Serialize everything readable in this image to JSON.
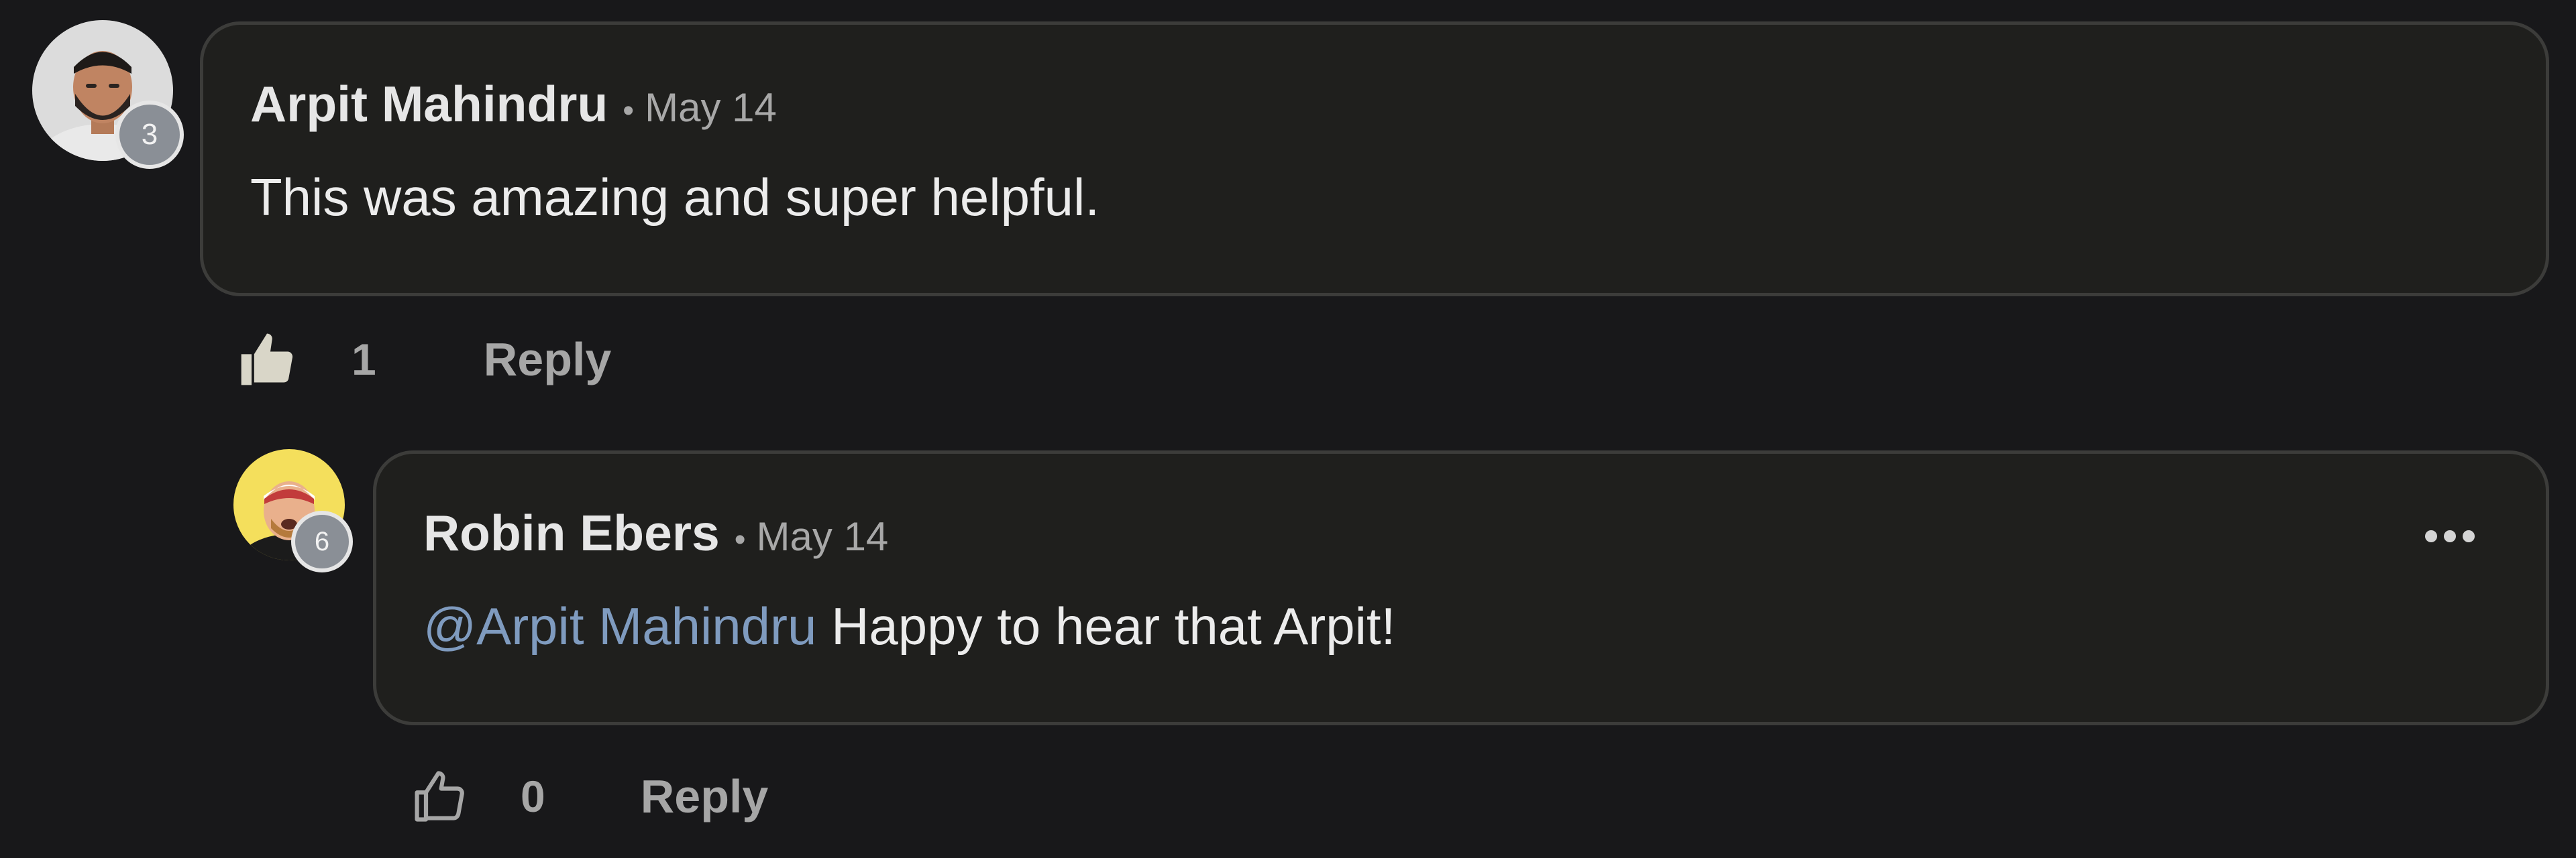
{
  "comments": [
    {
      "author": "Arpit Mahindru",
      "separator": "•",
      "date": "May 14",
      "level": "3",
      "text": "This was amazing and super helpful.",
      "like_count": "1",
      "reply_label": "Reply",
      "liked": true
    },
    {
      "author": "Robin Ebers",
      "separator": "•",
      "date": "May 14",
      "level": "6",
      "mention": "@Arpit Mahindru",
      "text": " Happy to hear that Arpit!",
      "like_count": "0",
      "reply_label": "Reply",
      "liked": false
    }
  ],
  "icons": {
    "like_filled": "thumbs-up-filled-icon",
    "like_outline": "thumbs-up-outline-icon",
    "more": "more-horizontal-icon"
  },
  "colors": {
    "background": "#18181a",
    "card": "#1f1f1d",
    "mention": "#7f9bbf",
    "liked_icon": "#d9d6c8"
  }
}
